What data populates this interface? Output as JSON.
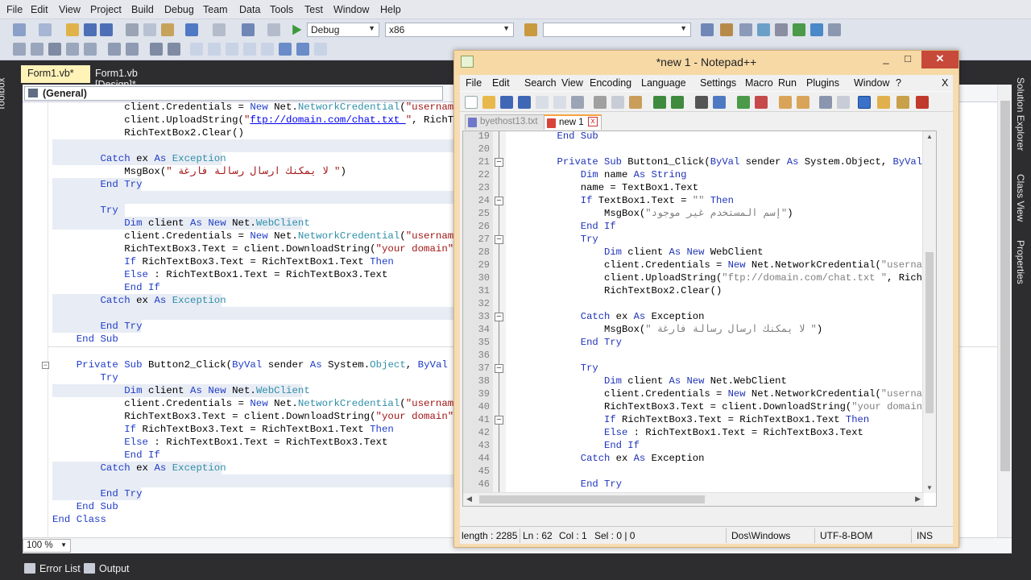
{
  "vs": {
    "menu": [
      "File",
      "Edit",
      "View",
      "Project",
      "Build",
      "Debug",
      "Team",
      "Data",
      "Tools",
      "Test",
      "Window",
      "Help"
    ],
    "toolbar": {
      "config": "Debug",
      "platform": "x86",
      "search_value": ""
    },
    "side_tabs": {
      "left": "Toolbox",
      "right": [
        "Solution Explorer",
        "Class View",
        "Properties"
      ]
    },
    "doc_tabs": [
      "Form1.vb*",
      "Form1.vb [Design]*"
    ],
    "nav_combo": "(General)",
    "zoom": "100 %",
    "status_buttons": [
      "Error List",
      "Output"
    ]
  },
  "npp": {
    "title": "*new 1 - Notepad++",
    "window_buttons": [
      "_",
      "□",
      "✕"
    ],
    "menu": [
      "File",
      "Edit",
      "Search",
      "View",
      "Encoding",
      "Language",
      "Settings",
      "Macro",
      "Run",
      "Plugins",
      "Window",
      "?"
    ],
    "menu_close": "X",
    "tabs": [
      "byethost13.txt",
      "new 1"
    ],
    "tab_close": "x",
    "status": {
      "length": "length : 2285",
      "line": "Ln : 62",
      "col": "Col : 1",
      "sel": "Sel : 0 | 0",
      "eol": "Dos\\Windows",
      "encoding": "UTF-8-BOM",
      "mode": "INS"
    }
  },
  "code_strings": {
    "username": "\"username\",",
    "ftp": "ftp://domain.com/chat.txt ",
    "cant_send": "\" لا يمكنك ارسال رسالة فارغة \"",
    "your_domain": "\"your domain\"",
    "user_missing": "\"إسم المستخدم غير موجود\"",
    "empty": "\"\""
  }
}
